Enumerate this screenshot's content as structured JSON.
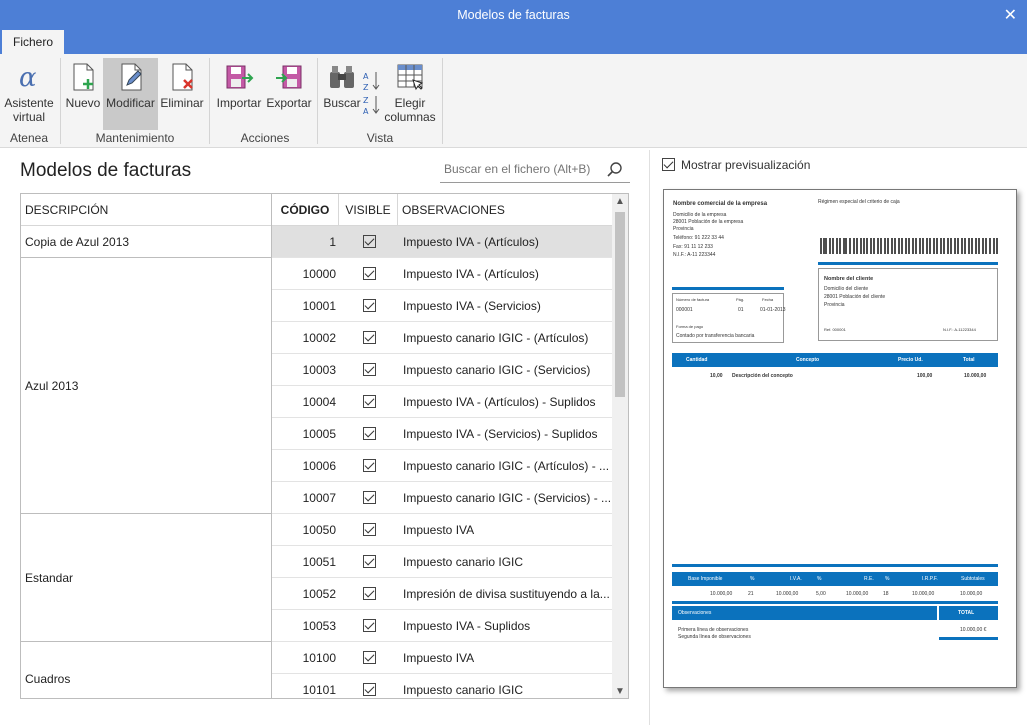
{
  "window": {
    "title": "Modelos de facturas",
    "close": "✕"
  },
  "ribbon": {
    "tab": "Fichero",
    "buttons": {
      "assistant": "Asistente virtual",
      "new": "Nuevo",
      "modify": "Modificar",
      "delete": "Eliminar",
      "import": "Importar",
      "export": "Exportar",
      "search": "Buscar",
      "columns": "Elegir columnas"
    },
    "groups": {
      "atenea": "Atenea",
      "mantenimiento": "Mantenimiento",
      "acciones": "Acciones",
      "vista": "Vista"
    }
  },
  "main": {
    "title": "Modelos de facturas",
    "search_placeholder": "Buscar en el fichero (Alt+B)"
  },
  "grid": {
    "headers": {
      "description": "DESCRIPCIÓN",
      "code": "CÓDIGO",
      "visible": "VISIBLE",
      "observations": "OBSERVACIONES"
    },
    "groups": [
      "Copia de Azul 2013",
      "Azul 2013",
      "Estandar",
      "Cuadros"
    ],
    "rows": [
      {
        "code": "1",
        "obs": "Impuesto IVA - (Artículos)"
      },
      {
        "code": "10000",
        "obs": "Impuesto IVA - (Artículos)"
      },
      {
        "code": "10001",
        "obs": "Impuesto IVA - (Servicios)"
      },
      {
        "code": "10002",
        "obs": "Impuesto canario IGIC - (Artículos)"
      },
      {
        "code": "10003",
        "obs": "Impuesto canario IGIC - (Servicios)"
      },
      {
        "code": "10004",
        "obs": "Impuesto IVA - (Artículos) - Suplidos"
      },
      {
        "code": "10005",
        "obs": "Impuesto IVA - (Servicios) - Suplidos"
      },
      {
        "code": "10006",
        "obs": "Impuesto canario IGIC - (Artículos) - ..."
      },
      {
        "code": "10007",
        "obs": "Impuesto canario IGIC - (Servicios) - ..."
      },
      {
        "code": "10050",
        "obs": "Impuesto IVA"
      },
      {
        "code": "10051",
        "obs": "Impuesto canario IGIC"
      },
      {
        "code": "10052",
        "obs": "Impresión de divisa sustituyendo a la..."
      },
      {
        "code": "10053",
        "obs": "Impuesto IVA - Suplidos"
      },
      {
        "code": "10100",
        "obs": "Impuesto IVA"
      },
      {
        "code": "10101",
        "obs": "Impuesto canario IGIC"
      }
    ]
  },
  "preview": {
    "toggle_label": "Mostrar previsualización",
    "doc": {
      "company": "Nombre comercial de la empresa",
      "regime": "Régimen especial del criterio de caja",
      "addr1": "Domicilio de la empresa",
      "addr2": "28001     Población de la empresa",
      "addr3": "Provincia",
      "phone": "Teléfono:   91 222 33 44",
      "fax": "Fax:   91 11 12 233",
      "nif": "N.I.F.:  A-11 223344",
      "client_title": "Nombre del cliente",
      "client1": "Domicilio del cliente",
      "client2": "28001 Población del cliente",
      "client3": "Provincia",
      "ref": "Ref.       000001",
      "cnif": "N.I.F.:   A-11223344",
      "inv_h1": "Número de factura",
      "inv_h2": "Pág.",
      "inv_h3": "Fecha",
      "inv_v1": "000001",
      "inv_v2": "01",
      "inv_v3": "01-01-2013",
      "pay_h": "Forma de pago",
      "pay_v": "Contado por transferencia bancaria",
      "th": [
        "Cantidad",
        "Concepto",
        "Precio Ud.",
        "Total"
      ],
      "line": [
        "10,00",
        "Descripción del concepto",
        "100,00",
        "10.000,00"
      ],
      "tot_h": [
        "Base Imponible",
        "%",
        "I.V.A.",
        "%",
        "R.E.",
        "%",
        "I.R.P.F.",
        "Subtotales"
      ],
      "tot_v": [
        "10.000,00",
        "21",
        "10.000,00",
        "5,00",
        "10.000,00",
        "18",
        "10.000,00",
        "10.000,00"
      ],
      "obs_h": "Observaciones",
      "total_h": "TOTAL",
      "obs1": "Primera línea de observaciones",
      "obs2": "Segunda línea de observaciones",
      "total_v": "10.000,00  €"
    }
  }
}
